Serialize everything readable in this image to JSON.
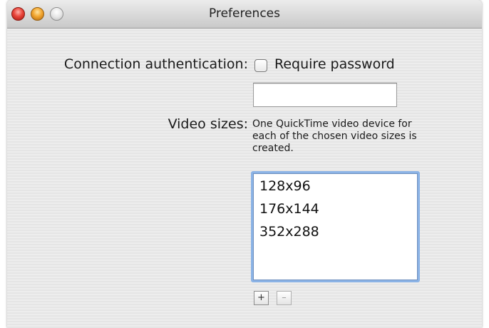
{
  "window": {
    "title": "Preferences"
  },
  "connection": {
    "label": "Connection authentication:",
    "checkbox_label": "Require password",
    "checkbox_checked": false,
    "password_value": ""
  },
  "video": {
    "label": "Video sizes:",
    "help_line1": "One QuickTime video device for",
    "help_line2": "each of the chosen video sizes is",
    "help_line3": "created.",
    "sizes": [
      "128x96",
      "176x144",
      "352x288"
    ],
    "add_label": "+",
    "remove_label": "–"
  },
  "colors": {
    "close": "#e8443a",
    "minimize": "#f2a630",
    "zoom": "#e6e6e6",
    "focus_ring": "#8bb3e6"
  }
}
